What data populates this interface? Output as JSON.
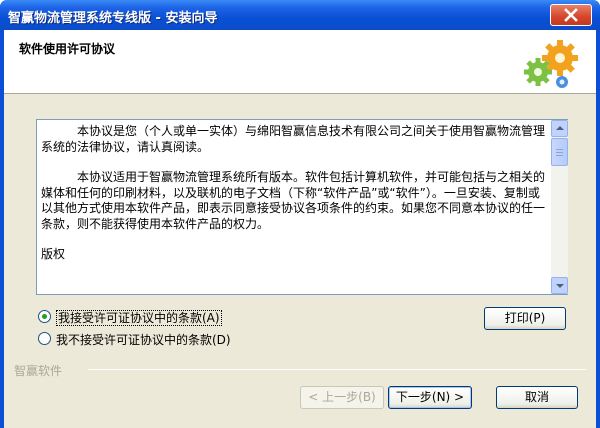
{
  "window": {
    "title": "智赢物流管理系统专线版 - 安装向导"
  },
  "header": {
    "title": "软件使用许可协议"
  },
  "license": {
    "paragraphs": [
      "本协议是您（个人或单一实体）与绵阳智赢信息技术有限公司之间关于使用智赢物流管理系统的法律协议，请认真阅读。",
      "本协议适用于智赢物流管理系统所有版本。软件包括计算机软件，并可能包括与之相关的媒体和任何的印刷材料，以及联机的电子文档（下称“软件产品”或“软件”）。一旦安装、复制或以其他方式使用本软件产品，即表示同意接受协议各项条件的约束。如果您不同意本协议的任一条款，则不能获得使用本软件产品的权力。",
      "版权"
    ]
  },
  "options": {
    "accept_label": "我接受许可证协议中的条款(A)",
    "decline_label": "我不接受许可证协议中的条款(D)",
    "selected": "accept"
  },
  "buttons": {
    "print": "打印(P)",
    "back": "< 上一步(B)",
    "next": "下一步(N) >",
    "cancel": "取消"
  },
  "footer": {
    "brand": "智赢软件"
  },
  "colors": {
    "titlebar": "#0b50d6",
    "dialog_bg": "#ece9d8",
    "radio_dot": "#21a121"
  }
}
